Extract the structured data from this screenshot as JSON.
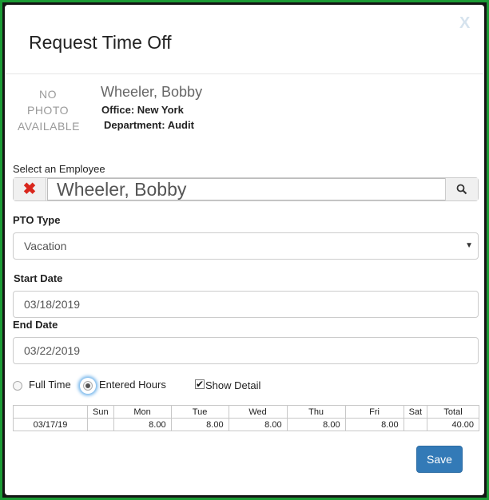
{
  "modal": {
    "title": "Request Time Off",
    "close_label": "X"
  },
  "employee": {
    "photo_lines": [
      "NO",
      "PHOTO",
      "AVAILABLE"
    ],
    "name": "Wheeler, Bobby",
    "office": "Office: New York",
    "department": "Department: Audit"
  },
  "select_employee": {
    "label": "Select an Employee",
    "value": "Wheeler, Bobby"
  },
  "pto_type": {
    "label": "PTO Type",
    "value": "Vacation"
  },
  "start_date": {
    "label": "Start Date",
    "value": "03/18/2019"
  },
  "end_date": {
    "label": "End Date",
    "value": "03/22/2019"
  },
  "hours_mode": {
    "full_time_label": "Full Time",
    "entered_hours_label": "Entered Hours",
    "selected": "entered_hours",
    "show_detail_label": "Show Detail",
    "show_detail_checked": true
  },
  "hours_table": {
    "columns": [
      "",
      "Sun",
      "Mon",
      "Tue",
      "Wed",
      "Thu",
      "Fri",
      "Sat",
      "Total"
    ],
    "rows": [
      [
        "03/17/19",
        "",
        "8.00",
        "8.00",
        "8.00",
        "8.00",
        "8.00",
        "",
        "40.00"
      ]
    ]
  },
  "footer": {
    "save_label": "Save"
  },
  "colors": {
    "frame_green": "#1c9b35",
    "primary_button": "#337ab7",
    "clear_red": "#d9261c"
  }
}
